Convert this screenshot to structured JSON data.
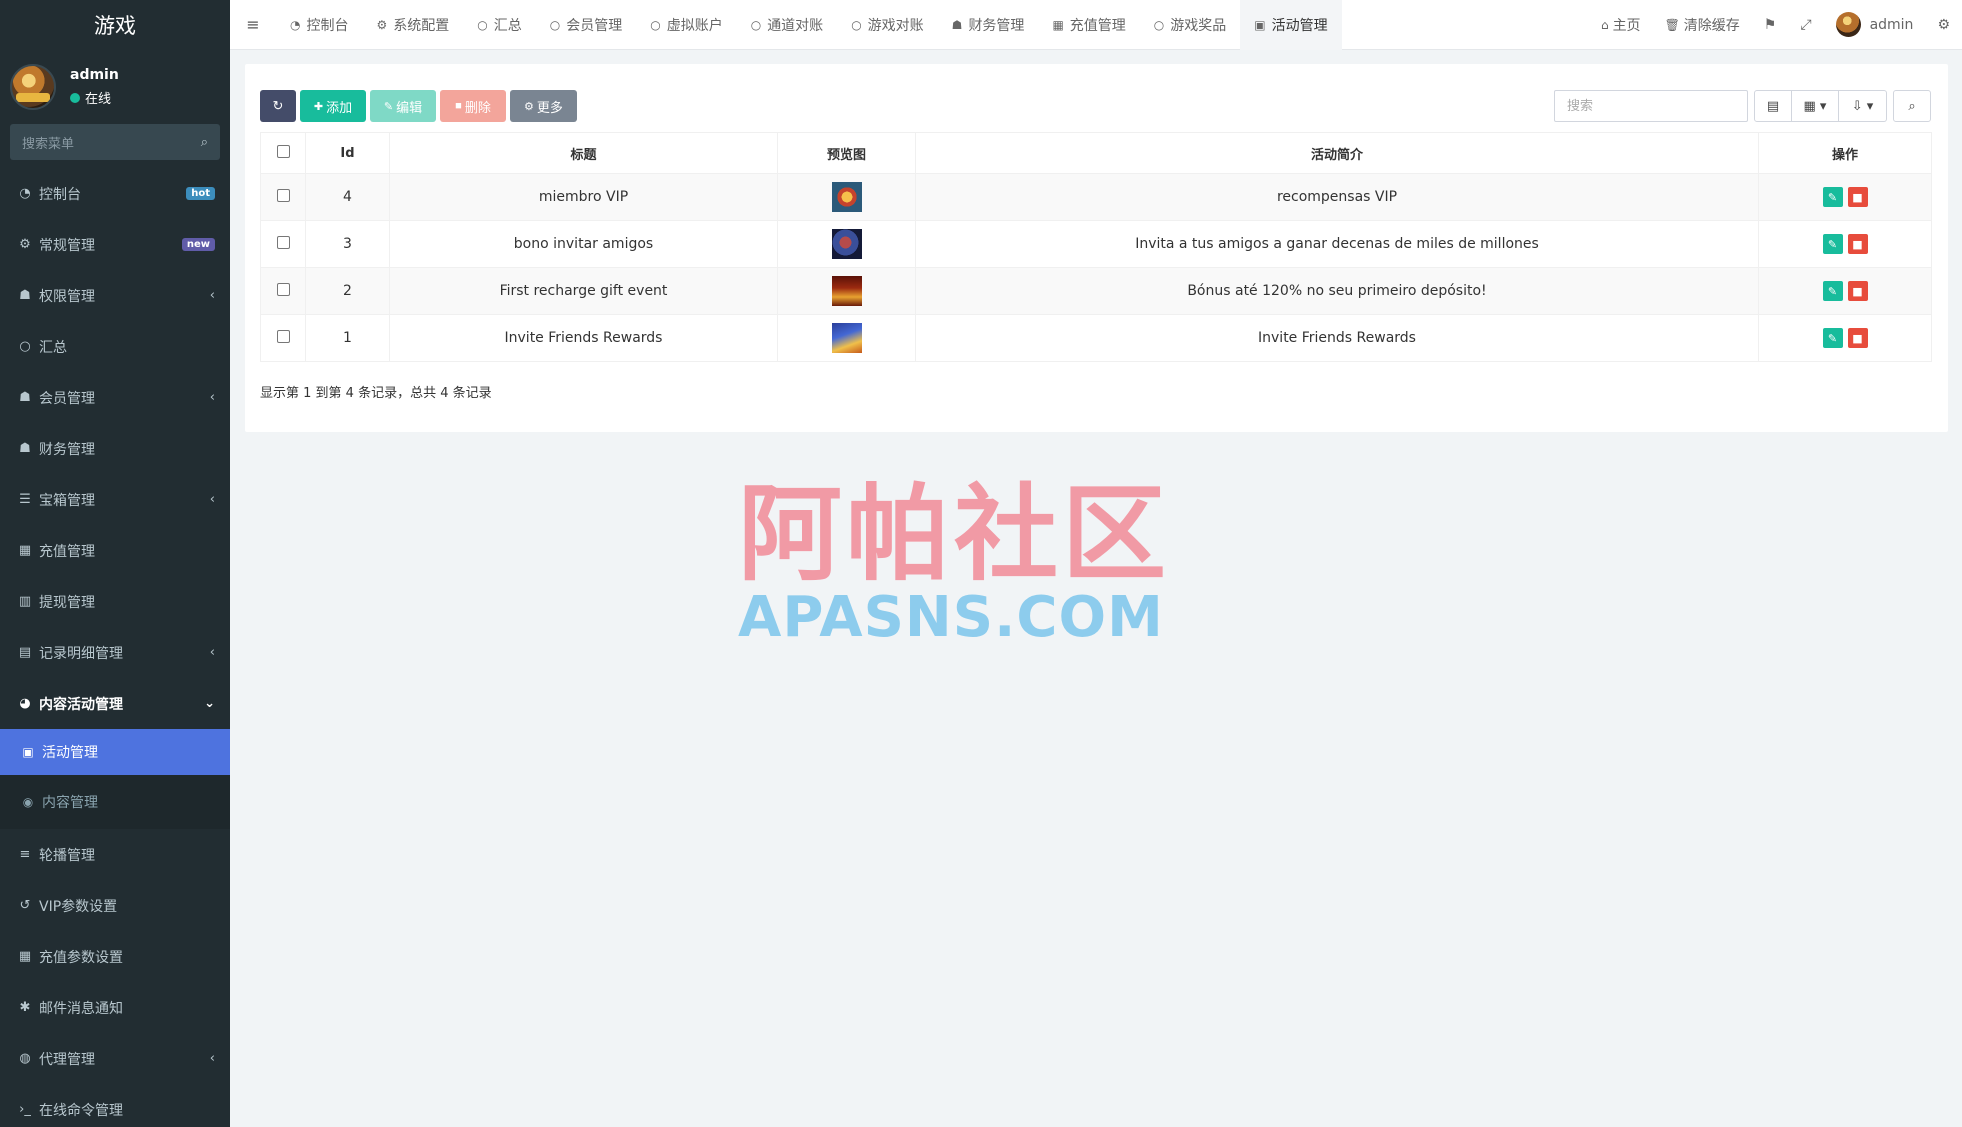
{
  "app": {
    "title": "游戏",
    "user_name": "admin",
    "user_status": "在线"
  },
  "sidebar": {
    "search_placeholder": "搜索菜单",
    "items": [
      {
        "label": "控制台",
        "icon": "dashboard-icon",
        "glyph": "◔",
        "badge": "hot"
      },
      {
        "label": "常规管理",
        "icon": "cogs-icon",
        "glyph": "⚙",
        "badge": "new"
      },
      {
        "label": "权限管理",
        "icon": "group-icon",
        "glyph": "☗",
        "chevron": "‹"
      },
      {
        "label": "汇总",
        "icon": "circle-icon",
        "glyph": "○"
      },
      {
        "label": "会员管理",
        "icon": "users-icon",
        "glyph": "☗",
        "chevron": "‹"
      },
      {
        "label": "财务管理",
        "icon": "users-icon",
        "glyph": "☗"
      },
      {
        "label": "宝箱管理",
        "icon": "list-icon",
        "glyph": "☰",
        "chevron": "‹"
      },
      {
        "label": "充值管理",
        "icon": "th-large-icon",
        "glyph": "▦"
      },
      {
        "label": "提现管理",
        "icon": "bar-chart-icon",
        "glyph": "▥"
      },
      {
        "label": "记录明细管理",
        "icon": "line-chart-icon",
        "glyph": "▤",
        "chevron": "‹"
      },
      {
        "label": "内容活动管理",
        "icon": "gauge-icon",
        "glyph": "◕",
        "chevron": "⌄"
      }
    ],
    "submenu": [
      {
        "label": "活动管理",
        "icon": "calendar-icon",
        "glyph": "▣"
      },
      {
        "label": "内容管理",
        "icon": "check-circle-icon",
        "glyph": "◉"
      }
    ],
    "items_after": [
      {
        "label": "轮播管理",
        "icon": "bars-icon",
        "glyph": "≡"
      },
      {
        "label": "VIP参数设置",
        "icon": "history-icon",
        "glyph": "↺"
      },
      {
        "label": "充值参数设置",
        "icon": "th-icon",
        "glyph": "▦"
      },
      {
        "label": "邮件消息通知",
        "icon": "asterisk-icon",
        "glyph": "✱"
      },
      {
        "label": "代理管理",
        "icon": "user-circle-icon",
        "glyph": "◍",
        "chevron": "‹"
      },
      {
        "label": "在线命令管理",
        "icon": "terminal-icon",
        "glyph": "›_"
      }
    ]
  },
  "navbar": {
    "toggle_glyph": "≡",
    "tabs": [
      {
        "label": "控制台",
        "icon": "dashboard-icon",
        "glyph": "◔"
      },
      {
        "label": "系统配置",
        "icon": "cog-icon",
        "glyph": "⚙"
      },
      {
        "label": "汇总",
        "icon": "circle-icon",
        "glyph": "○"
      },
      {
        "label": "会员管理",
        "icon": "circle-icon",
        "glyph": "○"
      },
      {
        "label": "虚拟账户",
        "icon": "circle-icon",
        "glyph": "○"
      },
      {
        "label": "通道对账",
        "icon": "circle-icon",
        "glyph": "○"
      },
      {
        "label": "游戏对账",
        "icon": "circle-icon",
        "glyph": "○"
      },
      {
        "label": "财务管理",
        "icon": "users-icon",
        "glyph": "☗"
      },
      {
        "label": "充值管理",
        "icon": "th-large-icon",
        "glyph": "▦"
      },
      {
        "label": "游戏奖品",
        "icon": "circle-icon",
        "glyph": "○"
      },
      {
        "label": "活动管理",
        "icon": "calendar-icon",
        "glyph": "▣"
      }
    ],
    "home_label": "主页",
    "clear_cache_label": "清除缓存",
    "user_name": "admin"
  },
  "toolbar": {
    "add_label": "添加",
    "edit_label": "编辑",
    "delete_label": "删除",
    "more_label": "更多",
    "search_placeholder": "搜索"
  },
  "table": {
    "headers": {
      "id": "Id",
      "title": "标题",
      "preview": "预览图",
      "intro": "活动简介",
      "ops": "操作"
    },
    "rows": [
      {
        "id": "4",
        "title": "miembro VIP",
        "intro": "recompensas VIP"
      },
      {
        "id": "3",
        "title": "bono invitar amigos",
        "intro": "Invita a tus amigos a ganar decenas de miles de millones"
      },
      {
        "id": "2",
        "title": "First recharge gift event",
        "intro": "Bónus até 120% no seu primeiro depósito!"
      },
      {
        "id": "1",
        "title": "Invite Friends Rewards",
        "intro": "Invite Friends Rewards"
      }
    ],
    "pagination_info": "显示第 1 到第 4 条记录，总共 4 条记录"
  },
  "watermark": {
    "cn": "阿帕社区",
    "en": "APASNS.COM"
  },
  "colors": {
    "sidebar_bg": "#222d32",
    "active_menu": "#4e73df",
    "primary_green": "#18bc9c",
    "danger_red": "#e74c3c"
  }
}
